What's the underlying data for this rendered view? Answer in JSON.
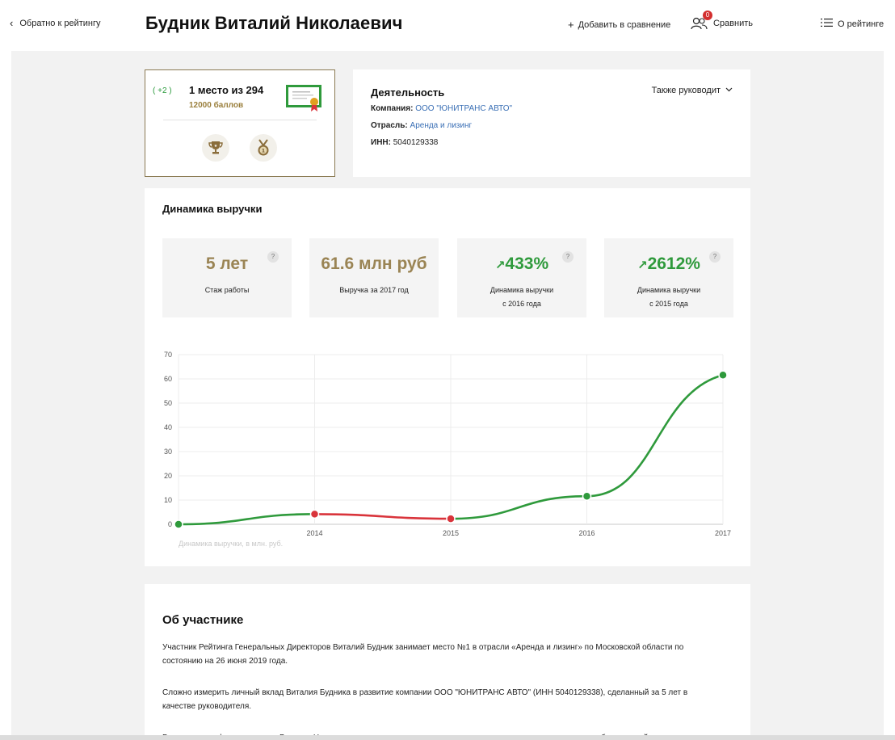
{
  "header": {
    "back_label": "Обратно к рейтингу",
    "title": "Будник Виталий Николаевич",
    "add_compare_label": "Добавить в сравнение",
    "compare_label": "Сравнить",
    "compare_count": "0",
    "about_rating_label": "О рейтинге"
  },
  "rank": {
    "delta": "( +2 )",
    "place": "1 место из 294",
    "points": "12000 баллов"
  },
  "activity": {
    "title": "Деятельность",
    "also_leads": "Также руководит",
    "company_label": "Компания:",
    "company_value": "ООО \"ЮНИТРАНС АВТО\"",
    "industry_label": "Отрасль:",
    "industry_value": "Аренда и лизинг",
    "inn_label": "ИНН:",
    "inn_value": "5040129338"
  },
  "revenue": {
    "title": "Динамика выручки",
    "stats": [
      {
        "value": "5 лет",
        "caption": "Стаж работы",
        "help": "?"
      },
      {
        "value": "61.6 млн руб",
        "caption": "Выручка за 2017 год",
        "help": "?"
      },
      {
        "value": "433%",
        "arrow": "↗",
        "caption": "Динамика выручки с 2016 года",
        "help": "?"
      },
      {
        "value": "2612%",
        "arrow": "↗",
        "caption": "Динамика выручки с 2015 года",
        "help": "?"
      }
    ]
  },
  "chart_data": {
    "type": "line",
    "x": [
      2013,
      2014,
      2015,
      2016,
      2017
    ],
    "tick_labels": [
      "2014",
      "2015",
      "2016",
      "2017"
    ],
    "values": [
      0,
      4.2,
      2.3,
      11.6,
      61.6
    ],
    "ylim": [
      0,
      70
    ],
    "yticks": [
      0,
      10,
      20,
      30,
      40,
      50,
      60,
      70
    ],
    "xlabel": "Динамика выручки, в млн. руб.",
    "grid": true,
    "colors": {
      "up": "#2f9a3c",
      "down": "#d9343b"
    }
  },
  "about": {
    "title": "Об участнике",
    "p1": "Участник Рейтинга Генеральных Директоров Виталий Будник занимает место №1 в отрасли «Аренда и лизинг» по Московской области по состоянию на 26 июня 2019 года.",
    "p2": "Сложно измерить личный вклад Виталия Будника в развитие компании ООО \"ЮНИТРАНС АВТО\" (ИНН 5040129338), сделанный за 5 лет в качестве руководителя.",
    "p3": "Благодаря профессионализму Виталия Николаевича, качественному и ответственному выполнению должностных обязанностей"
  }
}
